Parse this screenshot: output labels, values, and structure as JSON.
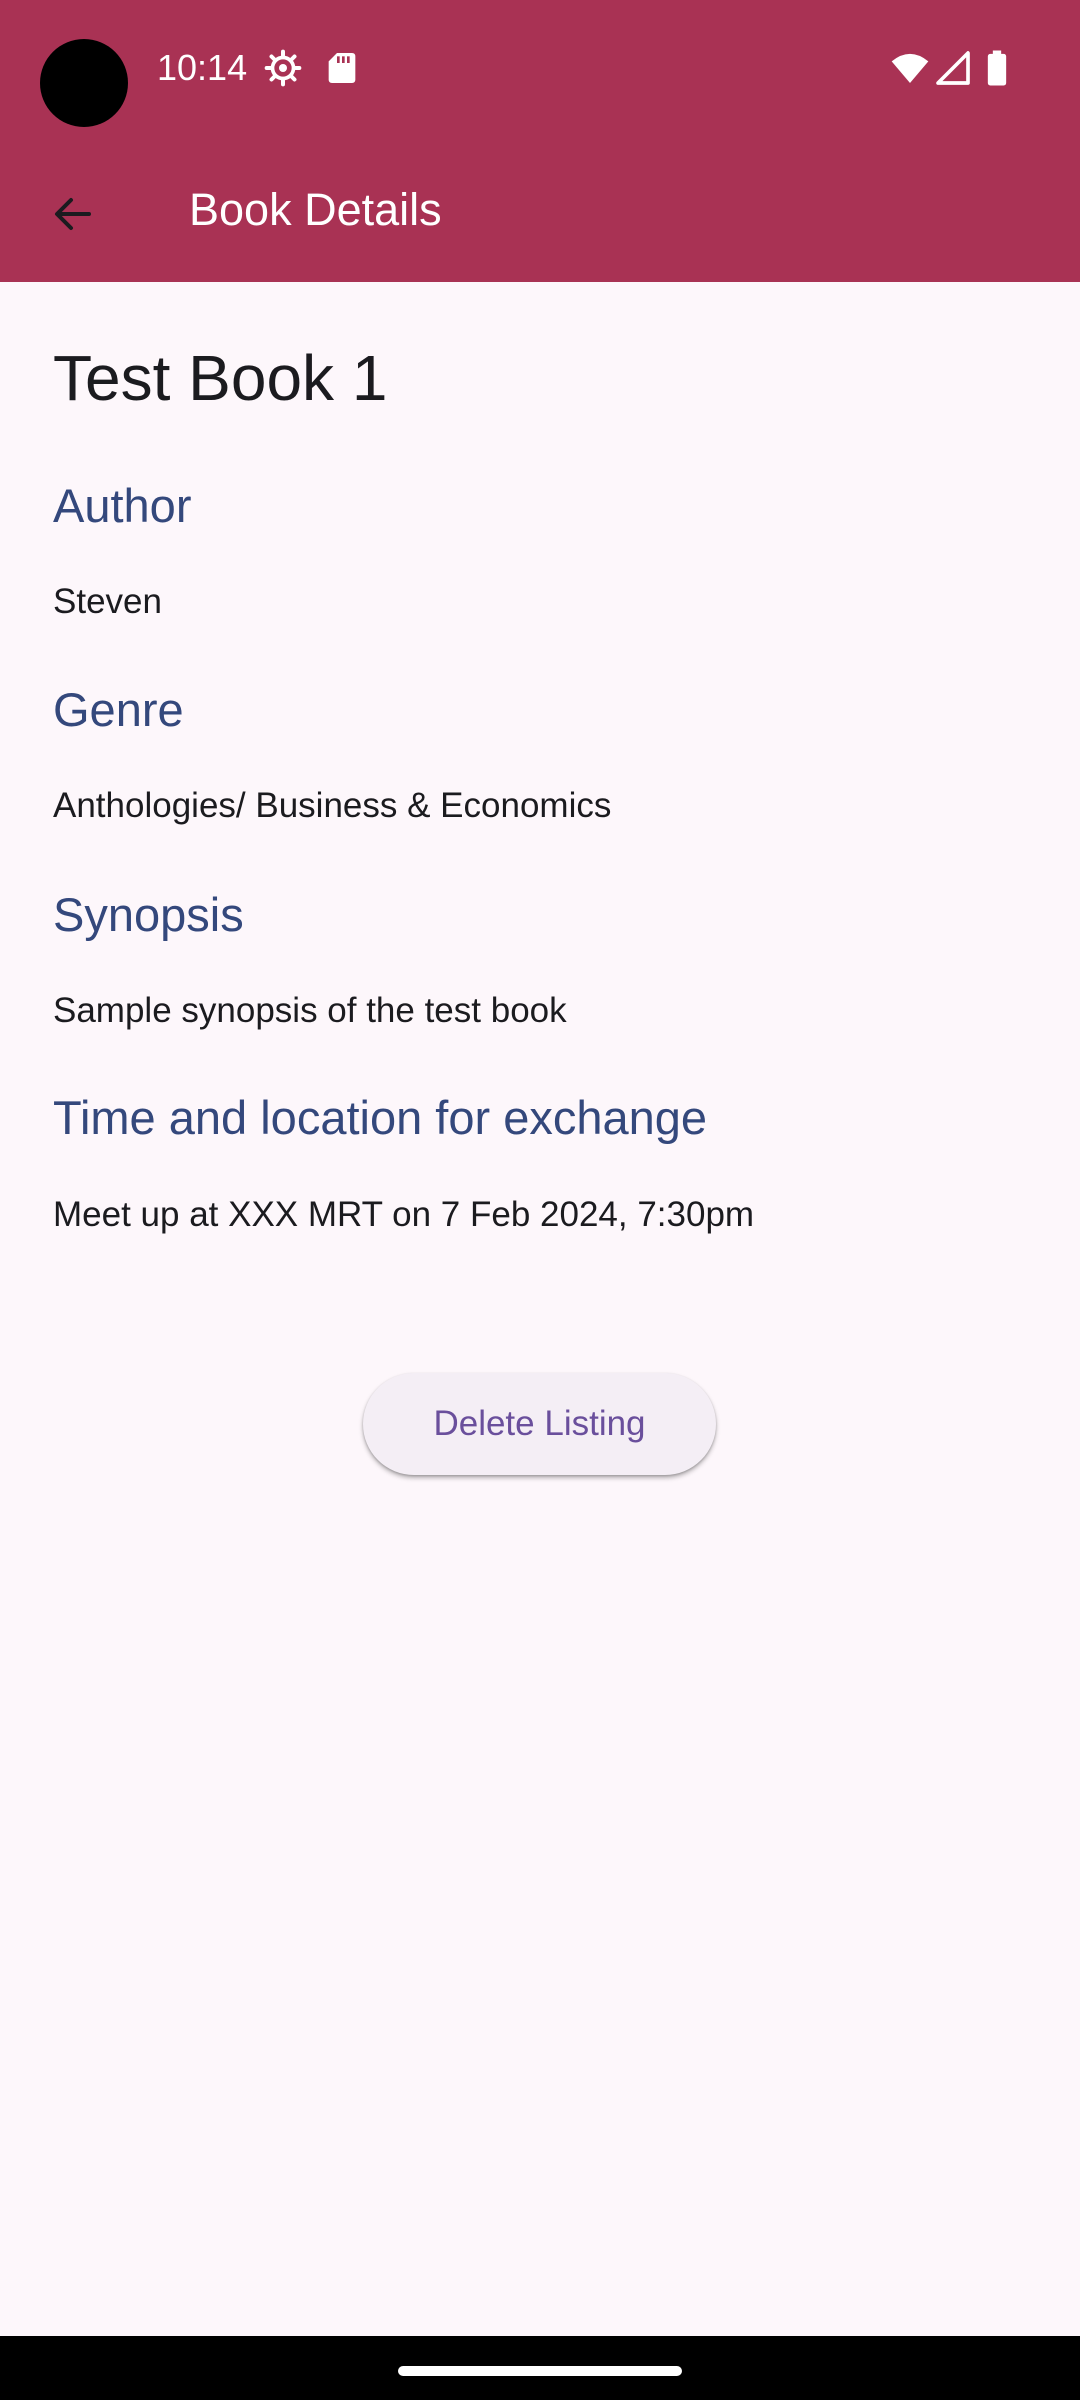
{
  "status_bar": {
    "time": "10:14",
    "icons": [
      "settings-gear-icon",
      "sd-card-icon",
      "wifi-icon",
      "cellular-signal-icon",
      "battery-icon"
    ]
  },
  "app_bar": {
    "back_icon": "arrow-back-icon",
    "title": "Book Details"
  },
  "book": {
    "title": "Test Book 1",
    "sections": [
      {
        "heading": "Author",
        "value": "Steven"
      },
      {
        "heading": "Genre",
        "value": "Anthologies/ Business & Economics"
      },
      {
        "heading": "Synopsis",
        "value": "Sample synopsis of the test book"
      },
      {
        "heading": "Time and location for exchange",
        "value": "Meet up at XXX MRT on 7 Feb 2024, 7:30pm"
      }
    ]
  },
  "actions": {
    "delete_label": "Delete Listing"
  },
  "colors": {
    "app_bar": "#a93254",
    "heading": "#34487c",
    "background": "#fdf7fb",
    "button_text": "#6a4f9c",
    "button_bg": "#f4eef5"
  }
}
